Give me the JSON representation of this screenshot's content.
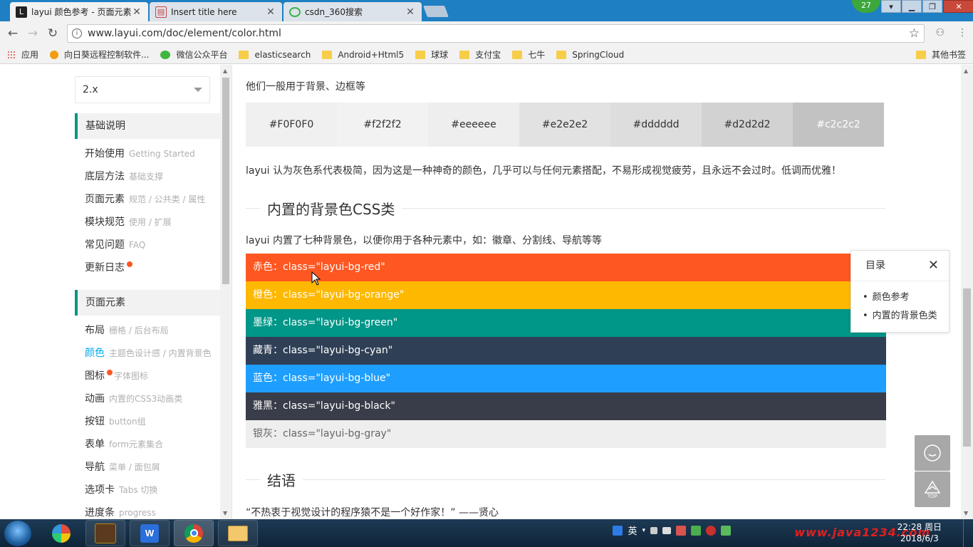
{
  "browser": {
    "tabs": [
      {
        "title": "layui 颜色参考 - 页面元素",
        "active": true
      },
      {
        "title": "Insert title here",
        "active": false
      },
      {
        "title": "csdn_360搜索",
        "active": false
      }
    ],
    "badge": "27",
    "url": "www.layui.com/doc/element/color.html",
    "bookmarks": [
      "应用",
      "向日葵远程控制软件...",
      "微信公众平台",
      "elasticsearch",
      "Android+Html5",
      "球球",
      "支付宝",
      "七牛",
      "SpringCloud"
    ],
    "other_bookmarks": "其他书签"
  },
  "sidebar": {
    "version": "2.x",
    "sections": [
      {
        "title": "基础说明",
        "items": [
          {
            "label": "开始使用",
            "sub": "Getting Started"
          },
          {
            "label": "底层方法",
            "sub": "基础支撑"
          },
          {
            "label": "页面元素",
            "sub": "规范 / 公共类 / 属性"
          },
          {
            "label": "模块规范",
            "sub": "使用 / 扩展"
          },
          {
            "label": "常见问题",
            "sub": "FAQ"
          },
          {
            "label": "更新日志",
            "sub": ""
          }
        ]
      },
      {
        "title": "页面元素",
        "items": [
          {
            "label": "布局",
            "sub": "栅格 / 后台布局"
          },
          {
            "label": "颜色",
            "sub": "主题色设计感 / 内置背景色"
          },
          {
            "label": "图标",
            "sub": "字体图标"
          },
          {
            "label": "动画",
            "sub": "内置的CSS3动画类"
          },
          {
            "label": "按钮",
            "sub": "button组"
          },
          {
            "label": "表单",
            "sub": "form元素集合"
          },
          {
            "label": "导航",
            "sub": "菜单 / 面包屑"
          },
          {
            "label": "选项卡",
            "sub": "Tabs 切换"
          },
          {
            "label": "进度条",
            "sub": "progress"
          }
        ]
      }
    ]
  },
  "content": {
    "gray_intro": "他们一般用于背景、边框等",
    "gray_swatches": [
      {
        "label": "#F0F0F0",
        "color": "#F0F0F0",
        "text_color": "#333333"
      },
      {
        "label": "#f2f2f2",
        "color": "#f2f2f2",
        "text_color": "#333333"
      },
      {
        "label": "#eeeeee",
        "color": "#eeeeee",
        "text_color": "#333333"
      },
      {
        "label": "#e2e2e2",
        "color": "#e2e2e2",
        "text_color": "#333333"
      },
      {
        "label": "#dddddd",
        "color": "#dddddd",
        "text_color": "#333333"
      },
      {
        "label": "#d2d2d2",
        "color": "#d2d2d2",
        "text_color": "#333333"
      },
      {
        "label": "#c2c2c2",
        "color": "#c2c2c2",
        "text_color": "#ffffff"
      }
    ],
    "gray_note": "layui 认为灰色系代表极简，因为这是一种神奇的颜色，几乎可以与任何元素搭配，不易形成视觉疲劳，且永远不会过时。低调而优雅！",
    "bg_section_title": "内置的背景色CSS类",
    "bg_intro": "layui 内置了七种背景色，以便你用于各种元素中，如：徽章、分割线、导航等等",
    "bg_classes": [
      {
        "label": "赤色：class=\"layui-bg-red\"",
        "color": "#FF5722",
        "text_color": "#ffffff"
      },
      {
        "label": "橙色：class=\"layui-bg-orange\"",
        "color": "#FFB800",
        "text_color": "#ffffff"
      },
      {
        "label": "墨绿：class=\"layui-bg-green\"",
        "color": "#009688",
        "text_color": "#ffffff"
      },
      {
        "label": "藏青：class=\"layui-bg-cyan\"",
        "color": "#2F4056",
        "text_color": "#ffffff"
      },
      {
        "label": "蓝色：class=\"layui-bg-blue\"",
        "color": "#1E9FFF",
        "text_color": "#ffffff"
      },
      {
        "label": "雅黑：class=\"layui-bg-black\"",
        "color": "#393D49",
        "text_color": "#ffffff"
      },
      {
        "label": "银灰：class=\"layui-bg-gray\"",
        "color": "#eeeeee",
        "text_color": "#666666"
      }
    ],
    "conclusion_title": "结语",
    "quote": "“不热衷于视觉设计的程序猿不是一个好作家！” ——贤心"
  },
  "toc": {
    "title": "目录",
    "items": [
      "颜色参考",
      "内置的背景色类"
    ]
  },
  "fixbar": {
    "top_label": "TOP"
  },
  "taskbar": {
    "ime": "英",
    "time": "22:28 周日",
    "date": "2018/6/3",
    "watermark": "www.java1234.com"
  },
  "colors": {
    "accent": "#009688",
    "active_link": "#01AAED",
    "badge_dot": "#FF5722"
  }
}
